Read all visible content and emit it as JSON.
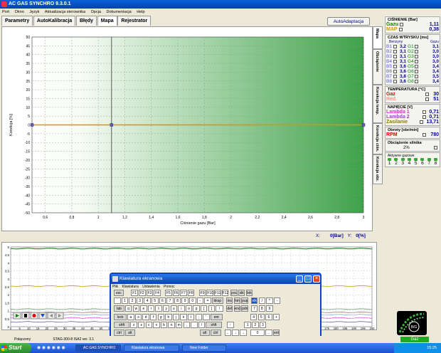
{
  "window": {
    "title": "AC GAS SYNCHRO  9.3.0.1"
  },
  "menu": [
    "Port",
    "Okno",
    "Język",
    "Aktualizacja sterownika",
    "Opcja",
    "Dokumentacja",
    "Help"
  ],
  "tabs": [
    "Parametry",
    "AutoKalibracja",
    "Błędy",
    "Mapa",
    "Rejestrator"
  ],
  "autoadaptacja": "AutoAdaptacja",
  "vertical_tabs": [
    "Mapa",
    "Obciążenie",
    "Korekcja temp.",
    "Korekcja ciśn.",
    "Korekcja obr."
  ],
  "chart_data": [
    {
      "type": "line",
      "xlabel": "Ciśnienie gazu [Bar]",
      "ylabel": "Korekcja [%]",
      "xlim": [
        0.5,
        3
      ],
      "ylim": [
        -50,
        50
      ],
      "x_ticks": [
        "0,6",
        "0,8",
        "1",
        "1,2",
        "1,4",
        "1,6",
        "1,8",
        "2",
        "2,2",
        "2,4",
        "2,6",
        "2,8",
        "3"
      ],
      "y_ticks": [
        "50",
        "45",
        "40",
        "35",
        "30",
        "25",
        "20",
        "15",
        "10",
        "5",
        "0",
        "-5",
        "-10",
        "-15",
        "-20",
        "-25",
        "-30",
        "-35",
        "-40",
        "-45",
        "-50"
      ],
      "series": [
        {
          "x": [
            0.5,
            1.1,
            3
          ],
          "y": [
            0,
            0,
            0
          ],
          "color": "#f08a00"
        }
      ],
      "cursor_x": 1.1,
      "grid": true
    },
    {
      "type": "line",
      "ylim": [
        0,
        5
      ],
      "y_ticks": [
        "5",
        "4,5",
        "4",
        "3,5",
        "3",
        "2,5",
        "2",
        "1,5",
        "1",
        "0,5",
        "0"
      ],
      "x_ticks": [
        "0",
        "5",
        "10",
        "15",
        "20",
        "25",
        "30",
        "35",
        "40",
        "45",
        "50",
        "55",
        "60",
        "65",
        "70",
        "75",
        "80",
        "85",
        "90",
        "95",
        "100",
        "105",
        "110",
        "115",
        "120",
        "125",
        "130",
        "135",
        "140",
        "145",
        "150",
        "155",
        "160",
        "165",
        "170",
        "175",
        "180",
        "185",
        "190",
        "195",
        "200"
      ],
      "grid": true
    }
  ],
  "readout": {
    "x_label": "X:",
    "x_value": "0[Bar]",
    "y_label": "Y:",
    "y_value": "0[%]"
  },
  "right_panel": {
    "pressure_title": "CIŚNIENIE [Bar]",
    "gazu_label": "Gazu",
    "gazu_value": "1,11",
    "map_label": "MAP",
    "map_value": "0,38",
    "injection_title": "CZAS WTRYSKU  [ms]",
    "benzyny_label": "Benzyny",
    "gazu_col_label": "Gazu",
    "cylinders": [
      {
        "b": "B1",
        "bv": "3,2",
        "g": "G1",
        "gv": "3,1"
      },
      {
        "b": "B2",
        "bv": "3,1",
        "g": "G2",
        "gv": "3,0"
      },
      {
        "b": "B3",
        "bv": "3,1",
        "g": "G3",
        "gv": "3,0"
      },
      {
        "b": "B4",
        "bv": "3,1",
        "g": "G4",
        "gv": "3,0"
      },
      {
        "b": "B5",
        "bv": "3,6",
        "g": "G5",
        "gv": "3,4"
      },
      {
        "b": "B6",
        "bv": "3,6",
        "g": "G6",
        "gv": "3,4"
      },
      {
        "b": "B7",
        "bv": "3,8",
        "g": "G7",
        "gv": "3,5"
      },
      {
        "b": "B8",
        "bv": "3,6",
        "g": "G8",
        "gv": "3,4"
      }
    ],
    "temp_title": "TEMPERATURA [°C]",
    "gaz_label": "Gaz",
    "gaz_value": "30",
    "red_label": "Red.",
    "red_value": "51",
    "voltage_title": "NAPIĘCIE [V]",
    "lambda1_label": "Lambda 1",
    "lambda1_value": "0,71",
    "lambda2_label": "Lambda 2",
    "lambda2_value": "0,71",
    "zasilanie_label": "Zasilanie",
    "zasilanie_value": "13,71",
    "obroty_title": "Obroty [obr/min]",
    "rpm_label": "RPM",
    "rpm_value": "780",
    "load_title": "Obciążenie silnika",
    "load_value": "2%",
    "injectors_title": "Aktywne gazowe",
    "injectors": [
      "1",
      "2",
      "3",
      "4",
      "5",
      "6",
      "7",
      "8"
    ]
  },
  "keyboard": {
    "title": "Klawiatura ekranowa",
    "menu": [
      "Plik",
      "Klawiatura",
      "Ustawienia",
      "Pomoc"
    ],
    "row0": [
      "esc",
      "F1",
      "F2",
      "F3",
      "F4",
      "F5",
      "F6",
      "F7",
      "F8",
      "F9",
      "F10",
      "F11",
      "F12",
      "psc",
      "slk",
      "brk"
    ],
    "row1": [
      "`",
      "1",
      "2",
      "3",
      "4",
      "5",
      "6",
      "7",
      "8",
      "9",
      "0",
      "-",
      "=",
      "bksp",
      "ins",
      "hm",
      "pup",
      "nlk",
      "/",
      "*",
      "-"
    ],
    "row2": [
      "tab",
      "q",
      "w",
      "e",
      "r",
      "t",
      "y",
      "u",
      "i",
      "o",
      "p",
      "[",
      "]",
      "\\",
      "del",
      "end",
      "pdn",
      "7",
      "8",
      "9"
    ],
    "row3": [
      "lock",
      "a",
      "s",
      "d",
      "f",
      "g",
      "h",
      "j",
      "k",
      "l",
      ";",
      "'",
      "ent",
      "4",
      "5",
      "6",
      "+"
    ],
    "row4": [
      "shft",
      "z",
      "x",
      "c",
      "v",
      "b",
      "n",
      "m",
      ",",
      ".",
      "/",
      "shft",
      "↑",
      "1",
      "2",
      "3"
    ],
    "row5": [
      "ctrl",
      "alt",
      "alt",
      "ctrl",
      "←",
      "↓",
      "→",
      "0",
      ",",
      "ent"
    ]
  },
  "logo_text": "B/G",
  "gaz_status": "Gaz",
  "statusbar": {
    "connection": "Połączony",
    "stag": "STAG-300-8 ISA2   ver. 3.1"
  },
  "taskbar": {
    "start": "Start",
    "items": [
      "AC GAS SYNCHRO",
      "Klawiatura ekranowa",
      "New Folder"
    ],
    "time": "15:25"
  }
}
